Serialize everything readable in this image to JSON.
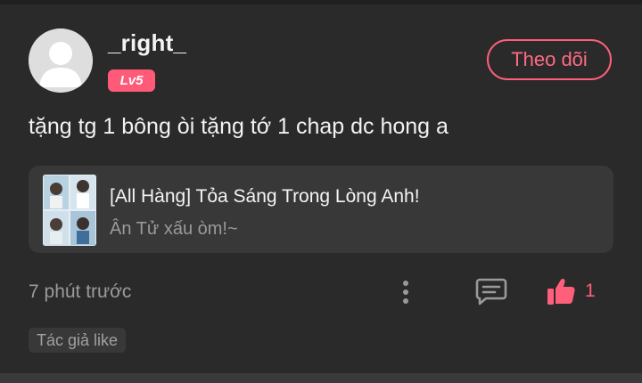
{
  "post": {
    "author": {
      "username": "_right_",
      "level": "Lv5",
      "avatar_icon": "default-user-avatar-icon"
    },
    "follow_label": "Theo dõi",
    "comment_text": "tặng tg 1 bông òi tặng tớ 1 chap dc hong a",
    "linked_story": {
      "title": "[All Hàng] Tỏa Sáng Trong Lòng Anh!",
      "subtitle": "Ân Tử xấu òm!~"
    },
    "timestamp": "7 phút trước",
    "like_count": "1",
    "author_like_label": "Tác giả like"
  },
  "colors": {
    "background": "#2a2a2a",
    "accent": "#ff5f7a",
    "card": "#383838",
    "muted_text": "#9a9a9a"
  },
  "icons": {
    "more": "more-vertical-icon",
    "comment": "comment-icon",
    "like": "thumbs-up-icon"
  }
}
